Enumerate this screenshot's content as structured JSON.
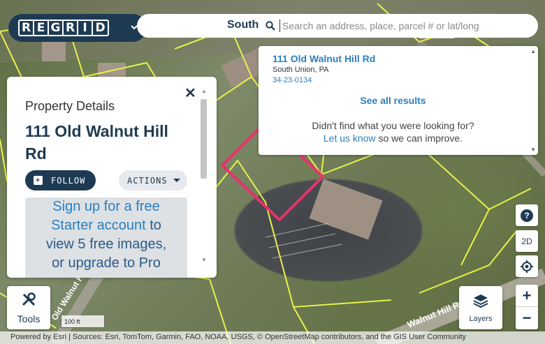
{
  "map": {
    "road_labels": [
      "Old Walnut Hill Rd",
      "Walnut Hill Rd"
    ],
    "parcel_highlight_color": "#e8336a",
    "parcel_line_color": "#e6f24a"
  },
  "brand": {
    "logo_letters": [
      "R",
      "E",
      "G",
      "R",
      "I",
      "D"
    ],
    "logo_bg": "#1e3a53"
  },
  "search": {
    "county": "South",
    "placeholder": "Search an address, place, parcel # or lat/long"
  },
  "results": {
    "title": "111 Old Walnut Hill Rd",
    "location": "South Union, PA",
    "parcel_id": "34-23-0134",
    "see_all": "See all results",
    "not_found": "Didn't find what you were looking for?",
    "let_us_know": "Let us know",
    "improve": " so we can improve."
  },
  "panel": {
    "label": "Property Details",
    "title": "111 Old Walnut Hill Rd",
    "follow": "FOLLOW",
    "actions": "ACTIONS",
    "promo_signup": "Sign up for a free",
    "promo_starter": "Starter account",
    "promo_to": " to",
    "promo_view": "view 5 free images,",
    "promo_upgrade": "or upgrade to Pro"
  },
  "controls": {
    "help": "?",
    "view_mode": "2D",
    "zoom_in": "+",
    "zoom_out": "−"
  },
  "tools": {
    "label": "Tools"
  },
  "layers": {
    "label": "Layers"
  },
  "scale": {
    "label": "100 ft"
  },
  "attribution": {
    "text": "Powered by Esri | Sources: Esri, TomTom, Garmin, FAO, NOAA, USGS, © OpenStreetMap contributors, and the GIS User Community"
  }
}
